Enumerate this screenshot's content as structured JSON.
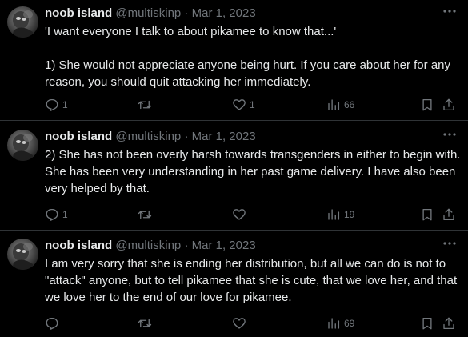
{
  "colors": {
    "background": "#000000",
    "text_primary": "#e7e9ea",
    "text_secondary": "#71767b",
    "divider": "#2f3336"
  },
  "tweets": [
    {
      "author_name": "noob island",
      "handle": "@multiskinp",
      "separator": "·",
      "date": "Mar 1, 2023",
      "text": "'I want everyone I talk to about pikamee to know that...'\n\n1) She would not appreciate anyone being hurt. If you care about her for any reason, you should quit attacking her immediately.",
      "replies": "1",
      "retweets": "",
      "likes": "1",
      "views": "66",
      "icons": [
        "more-icon",
        "reply-icon",
        "retweet-icon",
        "like-icon",
        "views-icon",
        "bookmark-icon",
        "share-icon"
      ]
    },
    {
      "author_name": "noob island",
      "handle": "@multiskinp",
      "separator": "·",
      "date": "Mar 1, 2023",
      "text": "2) She has not been overly harsh towards transgenders in either to begin with. She has been very understanding in her past game delivery. I have also been very helped by that.",
      "replies": "1",
      "retweets": "",
      "likes": "",
      "views": "19",
      "icons": [
        "more-icon",
        "reply-icon",
        "retweet-icon",
        "like-icon",
        "views-icon",
        "bookmark-icon",
        "share-icon"
      ]
    },
    {
      "author_name": "noob island",
      "handle": "@multiskinp",
      "separator": "·",
      "date": "Mar 1, 2023",
      "text": "I am very sorry that she is ending her distribution, but all we can do is not to \"attack\" anyone, but to tell pikamee that she is cute, that we love her, and that we love her to the end of our love for pikamee.",
      "replies": "",
      "retweets": "",
      "likes": "",
      "views": "69",
      "icons": [
        "more-icon",
        "reply-icon",
        "retweet-icon",
        "like-icon",
        "views-icon",
        "bookmark-icon",
        "share-icon"
      ]
    }
  ]
}
